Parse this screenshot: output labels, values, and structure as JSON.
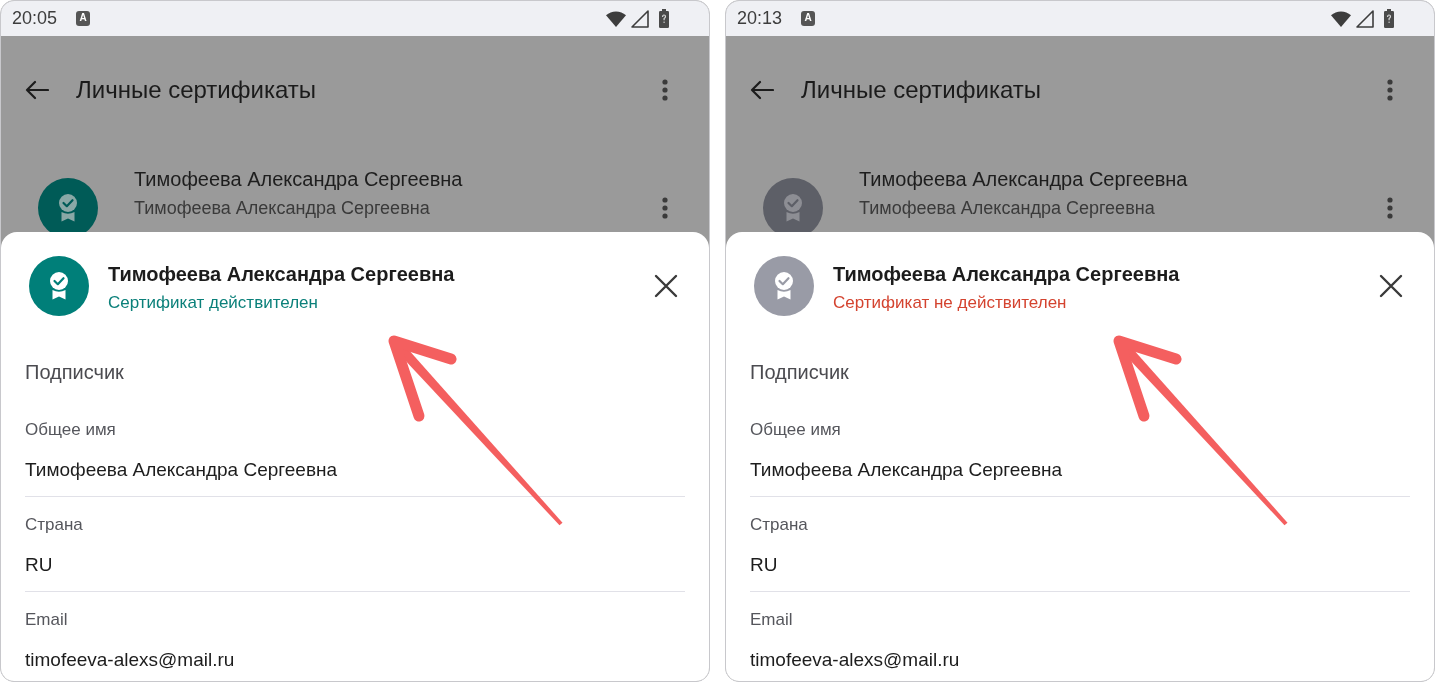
{
  "panels": [
    {
      "status_bar": {
        "time": "20:05",
        "notification": "A"
      },
      "app_bar": {
        "title": "Личные сертификаты"
      },
      "list_item": {
        "title": "Тимофеева Александра Сергеевна",
        "subtitle": "Тимофеева Александра Сергеевна",
        "valid": true
      },
      "sheet": {
        "title": "Тимофеева Александра Сергеевна",
        "status": "Сертификат действителен",
        "valid": true,
        "section": "Подписчик",
        "fields": [
          {
            "label": "Общее имя",
            "value": "Тимофеева Александра Сергеевна"
          },
          {
            "label": "Страна",
            "value": "RU"
          },
          {
            "label": "Email",
            "value": "timofeeva-alexs@mail.ru"
          }
        ]
      }
    },
    {
      "status_bar": {
        "time": "20:13",
        "notification": "A"
      },
      "app_bar": {
        "title": "Личные сертификаты"
      },
      "list_item": {
        "title": "Тимофеева Александра Сергеевна",
        "subtitle": "Тимофеева Александра Сергеевна",
        "valid": false
      },
      "sheet": {
        "title": "Тимофеева Александра Сергеевна",
        "status": "Сертификат не действителен",
        "valid": false,
        "section": "Подписчик",
        "fields": [
          {
            "label": "Общее имя",
            "value": "Тимофеева Александра Сергеевна"
          },
          {
            "label": "Страна",
            "value": "RU"
          },
          {
            "label": "Email",
            "value": "timofeeva-alexs@mail.ru"
          }
        ]
      }
    }
  ]
}
